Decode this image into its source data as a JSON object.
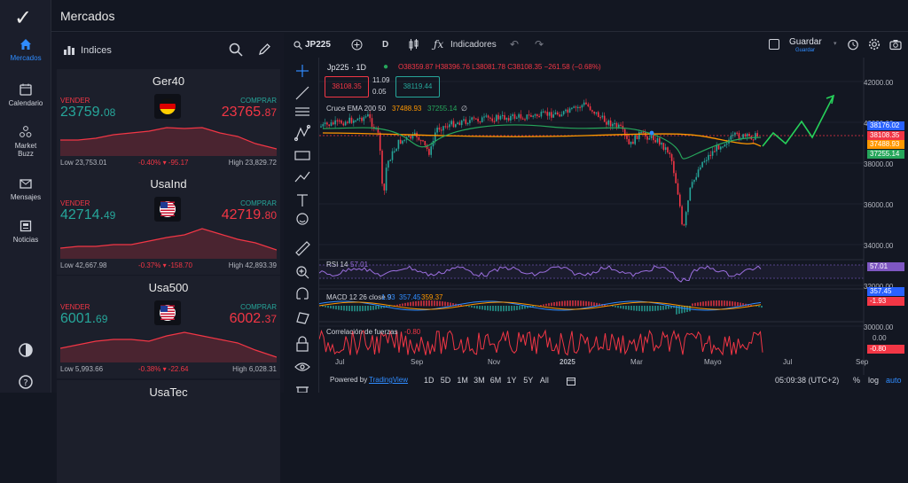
{
  "sidebar": {
    "logo": "✓",
    "items": [
      {
        "label": "Mercados",
        "icon": "home-icon"
      },
      {
        "label": "Calendario",
        "icon": "calendar-icon"
      },
      {
        "label": "Market Buzz",
        "icon": "buzz-icon"
      },
      {
        "label": "Mensajes",
        "icon": "mail-icon"
      },
      {
        "label": "Noticias",
        "icon": "news-icon"
      }
    ]
  },
  "header": {
    "title": "Mercados"
  },
  "panel": {
    "tab": "Indices",
    "cards": [
      {
        "name": "Ger40",
        "sell_label": "VENDER",
        "buy_label": "COMPRAR",
        "sell_main": "23759.",
        "sell_tail": "08",
        "buy_main": "23765.",
        "buy_tail": "87",
        "low": "Low 23,753.01",
        "change": "-0.40% ▾ -95.17",
        "high": "High 23,829.72",
        "flag": "de"
      },
      {
        "name": "UsaInd",
        "sell_label": "VENDER",
        "buy_label": "COMPRAR",
        "sell_main": "42714.",
        "sell_tail": "49",
        "buy_main": "42719.",
        "buy_tail": "80",
        "low": "Low 42,667.98",
        "change": "-0.37% ▾ -158.70",
        "high": "High 42,893.39",
        "flag": "us"
      },
      {
        "name": "Usa500",
        "sell_label": "VENDER",
        "buy_label": "COMPRAR",
        "sell_main": "6001.",
        "sell_tail": "69",
        "buy_main": "6002.",
        "buy_tail": "37",
        "low": "Low 5,993.66",
        "change": "-0.38% ▾ -22.64",
        "high": "High 6,028.31",
        "flag": "us"
      },
      {
        "name": "UsaTec"
      }
    ]
  },
  "chart": {
    "symbol": "JP225",
    "interval": "D",
    "indicators_label": "Indicadores",
    "save_label": "Guardar",
    "save_sub": "Guardar",
    "legend_title": "Jp225 · 1D",
    "ohlc": "O38359.87 H38396.76 L38081.78 C38108.35 −261.58 (−0.68%)",
    "sell_box": "38108.35",
    "spread_top": "11.09",
    "spread_bot": "0.05",
    "buy_box": "38119.44",
    "ema_label": "Cruce EMA 200 50",
    "ema_v1": "37488.93",
    "ema_v2": "37255.14",
    "ema_v3": "∅",
    "rsi_label": "RSI 14",
    "rsi_val": "57.01",
    "macd_label": "MACD 12 26 close 9",
    "macd_v1": "1.93",
    "macd_v2": "357.45",
    "macd_v3": "359.37",
    "corr_label": "Correlación de fuerzas",
    "corr_val": "-0.80",
    "price_ticks": [
      "42000.00",
      "40000.00",
      "38000.00",
      "36000.00",
      "34000.00",
      "32000.00",
      "30000.00"
    ],
    "price_badges": [
      {
        "v": "38176.02",
        "c": "#2962ff"
      },
      {
        "v": "38108.35",
        "c": "#f23645"
      },
      {
        "v": "37488.93",
        "c": "#ff9800"
      },
      {
        "v": "37255.14",
        "c": "#26a65b"
      }
    ],
    "rsi_badge": "57.01",
    "macd_badges": [
      "357.45",
      "-1.93"
    ],
    "corr_ticks": [
      "0.00",
      "-0.80"
    ],
    "x_labels": [
      "Jul",
      "Sep",
      "Nov",
      "2025",
      "Mar",
      "Mayo",
      "Jul",
      "Sep"
    ],
    "powered": "Powered by",
    "powered_link": "TradingView",
    "ranges": [
      "1D",
      "5D",
      "1M",
      "3M",
      "6M",
      "1Y",
      "5Y",
      "All"
    ],
    "clock": "05:09:38 (UTC+2)",
    "pct": "%",
    "log": "log",
    "auto": "auto"
  },
  "colors": {
    "buy": "#26a69a",
    "sell": "#f23645",
    "accent": "#2f8cff"
  }
}
